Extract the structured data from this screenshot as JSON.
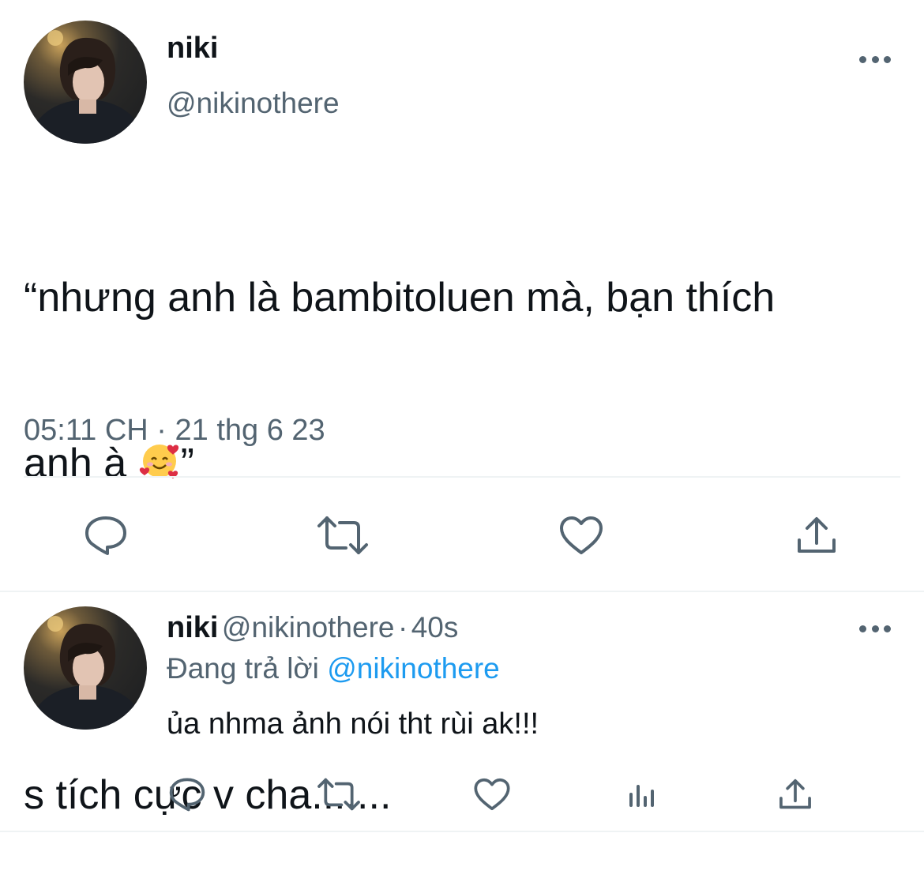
{
  "main_tweet": {
    "author_name": "niki",
    "author_handle": "@nikinothere",
    "text_line1": "“nhưng anh là bambitoluen mà, bạn thích",
    "text_line2_prefix": "anh à ",
    "text_line2_emoji": "smiling-face-with-hearts-icon",
    "text_line2_suffix": "”",
    "text_line3": "s tích cực v cha.......",
    "time": "05:11 CH",
    "separator": "·",
    "date": "21 thg 6 23",
    "actions": [
      "reply-icon",
      "retweet-icon",
      "like-icon",
      "share-icon"
    ]
  },
  "reply_tweet": {
    "author_name": "niki",
    "author_handle": "@nikinothere",
    "separator": "·",
    "time_ago": "40s",
    "replying_label": "Đang trả lời",
    "replying_to": "@nikinothere",
    "text": "ủa nhma ảnh nói tht rùi ak!!!",
    "actions": [
      "reply-icon",
      "retweet-icon",
      "like-icon",
      "analytics-icon",
      "share-icon"
    ]
  },
  "colors": {
    "text_primary": "#0f1419",
    "text_secondary": "#536471",
    "link": "#1d9bf0",
    "divider": "#eff3f4"
  }
}
